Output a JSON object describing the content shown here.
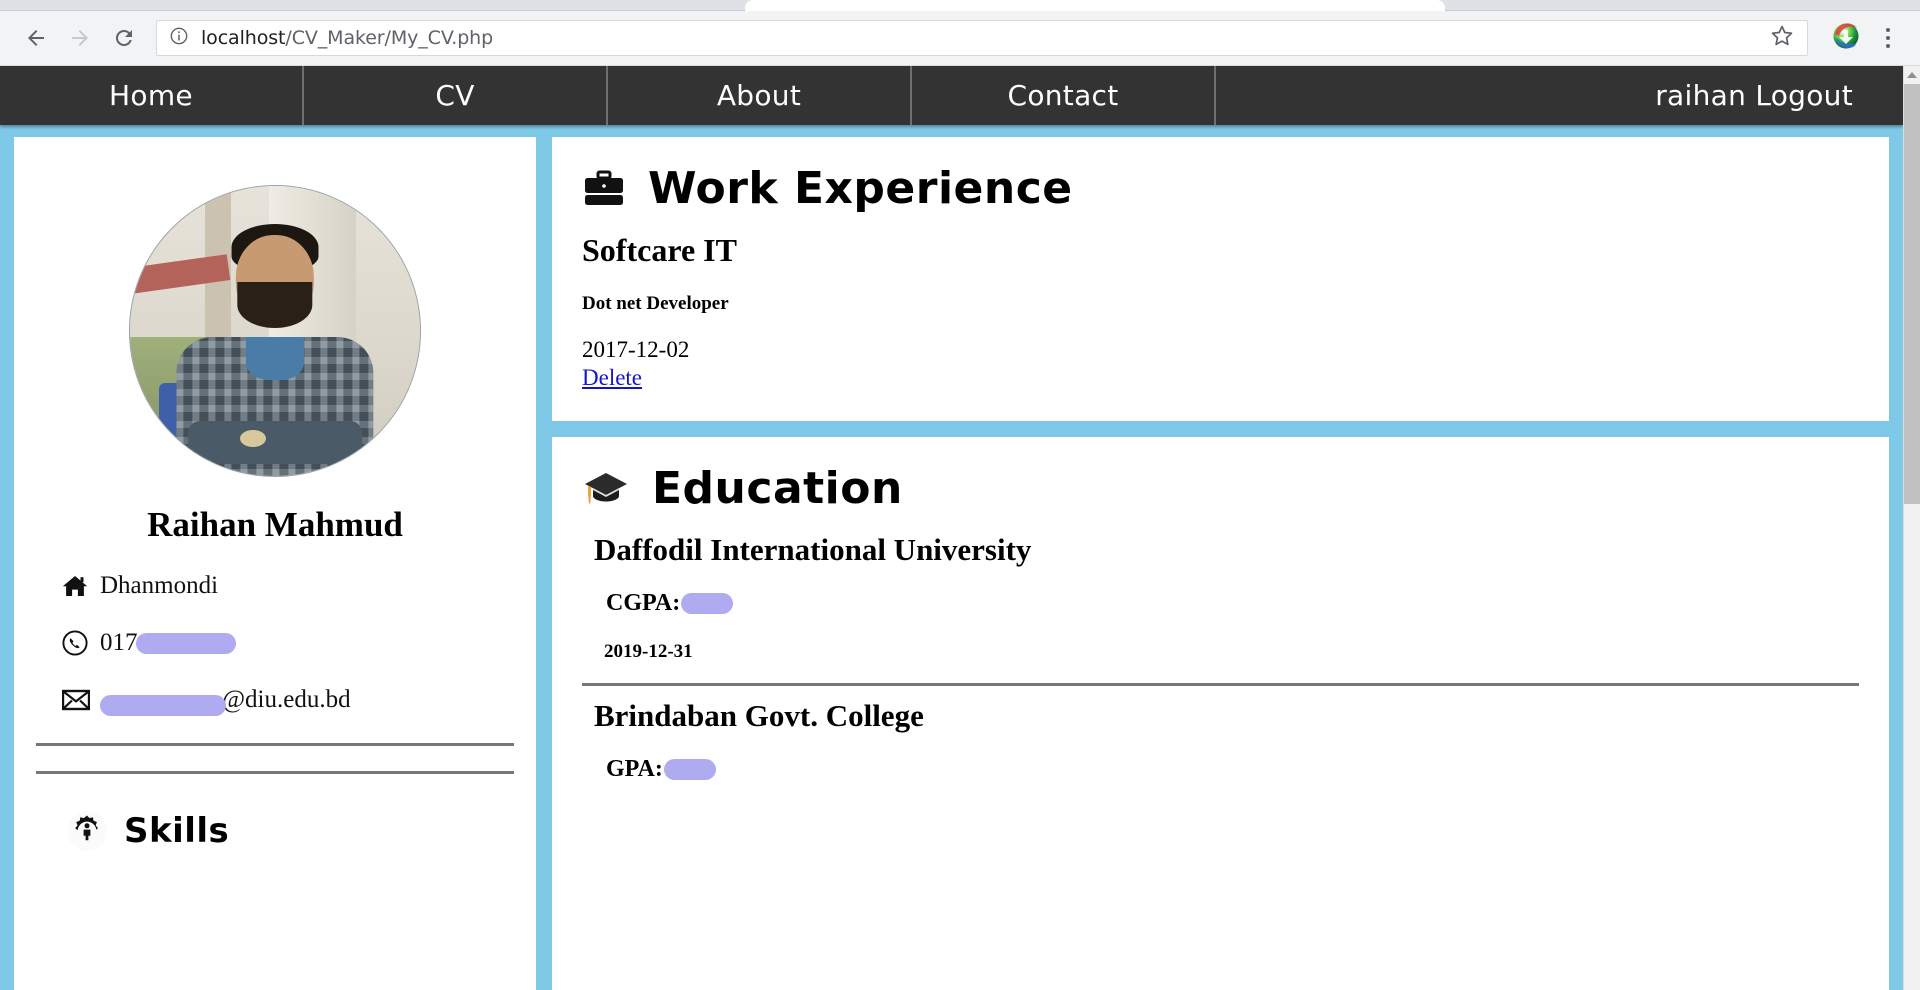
{
  "browser": {
    "back_icon": "back-arrow-icon",
    "forward_icon": "forward-arrow-icon",
    "reload_icon": "reload-icon",
    "info_icon": "info-icon",
    "url_host": "localhost",
    "url_path": "/CV_Maker/My_CV.php",
    "url_full": "localhost/CV_Maker/My_CV.php",
    "star_icon": "star-bookmark-icon",
    "extension_icon": "idm-extension-icon",
    "menu_icon": "three-dot-menu-icon"
  },
  "sitenav": {
    "items": [
      {
        "label": "Home"
      },
      {
        "label": "CV"
      },
      {
        "label": "About"
      },
      {
        "label": "Contact"
      }
    ],
    "user_logout": "raihan Logout"
  },
  "profile": {
    "avatar_alt": "profile-photo",
    "name": "Raihan Mahmud",
    "address_icon": "home-icon",
    "address": "Dhanmondi",
    "phone_icon": "phone-icon",
    "phone_visible": "017",
    "phone_redacted": true,
    "email_icon": "envelope-icon",
    "email_redacted": true,
    "email_domain": "@diu.edu.bd"
  },
  "skills": {
    "icon": "user-gear-icon",
    "title": "Skills"
  },
  "work": {
    "icon": "briefcase-icon",
    "title": "Work Experience",
    "entries": [
      {
        "company": "Softcare IT",
        "role": "Dot net Developer",
        "date": "2017-12-02",
        "delete_label": "Delete"
      }
    ]
  },
  "education": {
    "icon": "graduation-cap-icon",
    "title": "Education",
    "entries": [
      {
        "institution": "Daffodil International University",
        "grade_label": "CGPA:",
        "grade_redacted": true,
        "date": "2019-12-31"
      },
      {
        "institution": "Brindaban Govt. College",
        "grade_label": "GPA:",
        "grade_redacted": true,
        "date": ""
      }
    ]
  },
  "colors": {
    "page_background": "#7FC9E8",
    "nav_background": "#333333",
    "card_background": "#ffffff",
    "link": "#1414cf",
    "redaction": "#b0aaf0",
    "rule": "#777777"
  }
}
